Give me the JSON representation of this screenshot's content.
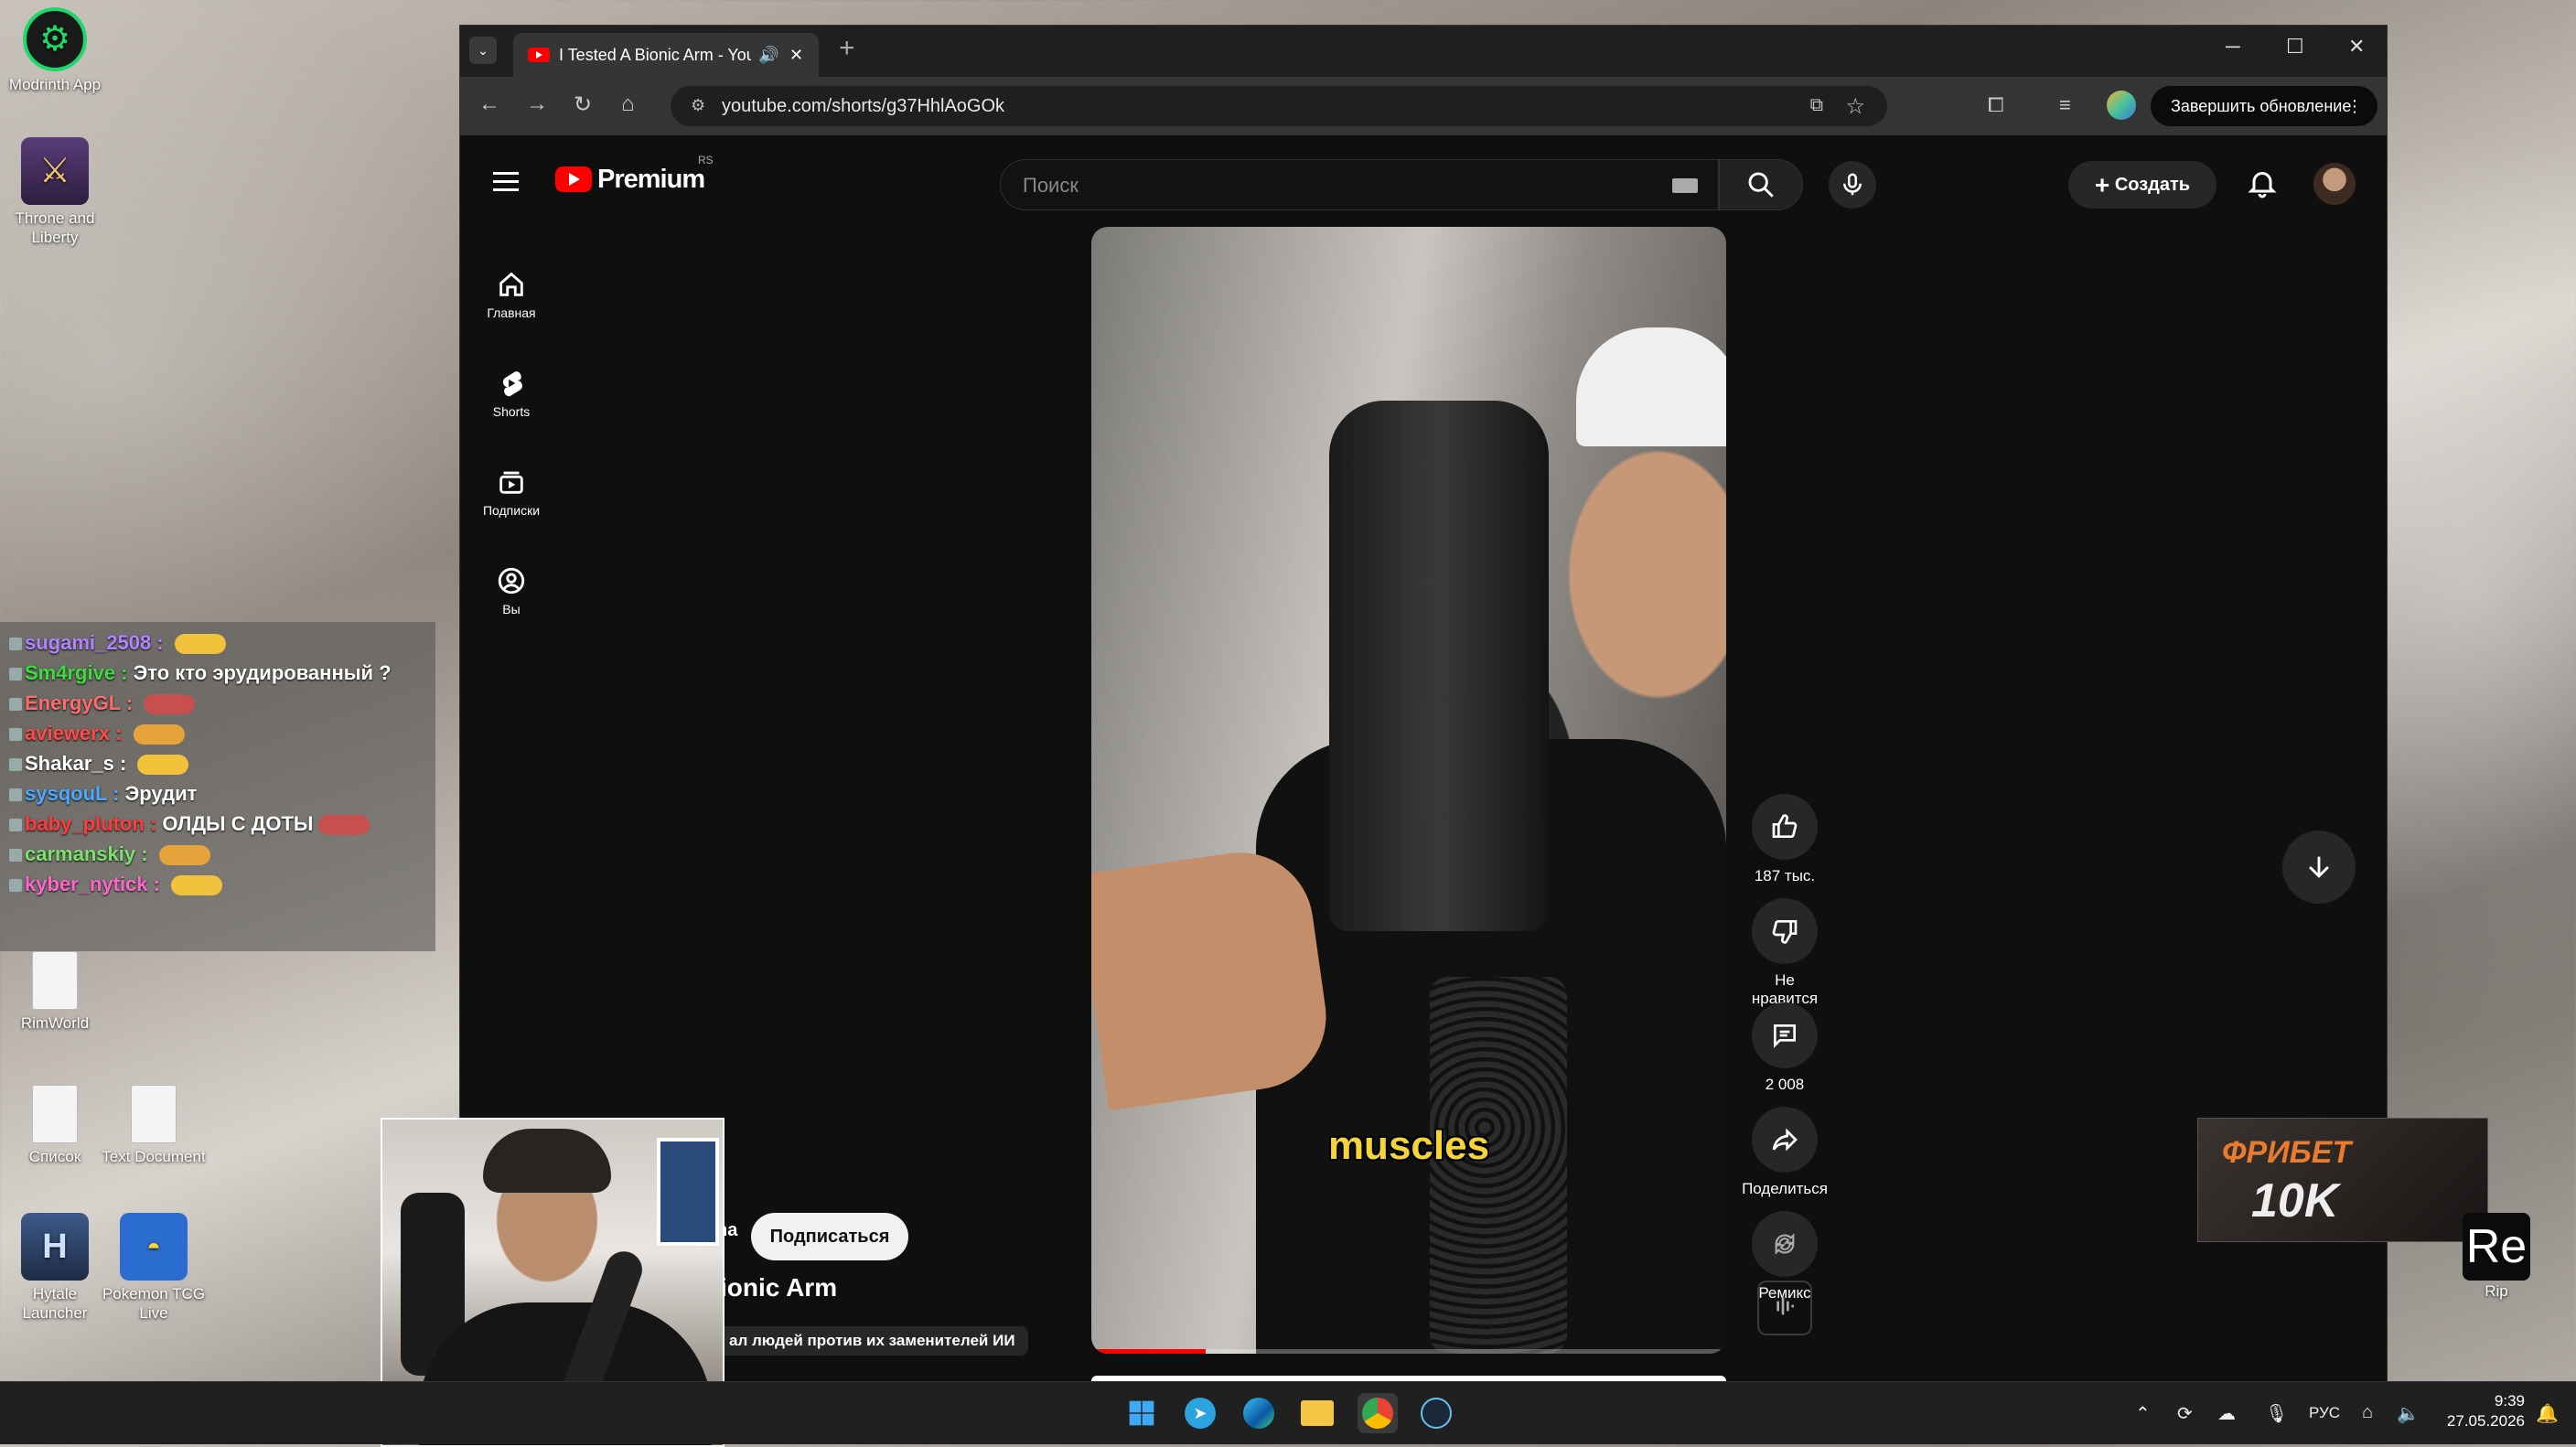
{
  "desktop": {
    "icons": [
      {
        "label": "Modrinth App"
      },
      {
        "label": "Throne and Liberty"
      },
      {
        "label": "RimWorld"
      },
      {
        "label": "Список"
      },
      {
        "label": "Text Document"
      },
      {
        "label": "Hytale Launcher"
      },
      {
        "label": "Pokemon TCG Live"
      }
    ]
  },
  "chat": {
    "messages": [
      {
        "user": "sugami_2508",
        "text": "",
        "color": "#b084ff"
      },
      {
        "user": "Sm4rgive",
        "text": "Это кто эрудированный ?",
        "color": "#3ddc3d"
      },
      {
        "user": "EnergyGL",
        "text": "",
        "color": "#ff6a6a"
      },
      {
        "user": "aviewerx",
        "text": "",
        "color": "#ff4a4a"
      },
      {
        "user": "Shakar_s",
        "text": "",
        "color": "#ffffff"
      },
      {
        "user": "sysqouL",
        "text": "Эрудит",
        "color": "#4aa8ff"
      },
      {
        "user": "baby_pluton",
        "text": "ОЛДЫ С ДОТЫ",
        "color": "#ff3b3b"
      },
      {
        "user": "carmanskiy",
        "text": "",
        "color": "#7be36b"
      },
      {
        "user": "kyber_nytick",
        "text": "",
        "color": "#ff66cc"
      }
    ]
  },
  "browser": {
    "tab": {
      "title": "I Tested A Bionic Arm - You"
    },
    "url": "youtube.com/shorts/g37HhlAoGOk",
    "update_button": "Завершить обновление"
  },
  "youtube": {
    "logo_text": "Premium",
    "region": "RS",
    "search_placeholder": "Поиск",
    "create_label": "Создать",
    "sidebar": [
      {
        "label": "Главная"
      },
      {
        "label": "Shorts"
      },
      {
        "label": "Подписки"
      },
      {
        "label": "Вы"
      }
    ],
    "actions": {
      "likes": "187 тыс.",
      "dislike": "Не нравится",
      "comments": "2 008",
      "share": "Поделиться",
      "remix": "Ремикс"
    },
    "caption": "muscles",
    "progress_fraction": 0.18,
    "channel_fragment": "ha",
    "subscribe_label": "Подписаться",
    "title_fragment": "ionic Arm",
    "description_fragment": "ал людей против их заменителей ИИ"
  },
  "ad": {
    "line1": "ФРИБЕТ",
    "line2": "10K",
    "icon_text": "Re",
    "icon_label": "Rip"
  },
  "taskbar": {
    "language": "РУС",
    "time": "9:39",
    "date": "27.05.2026"
  },
  "colors": {
    "youtube_red": "#ff0000",
    "caption_yellow": "#f5d43a"
  }
}
